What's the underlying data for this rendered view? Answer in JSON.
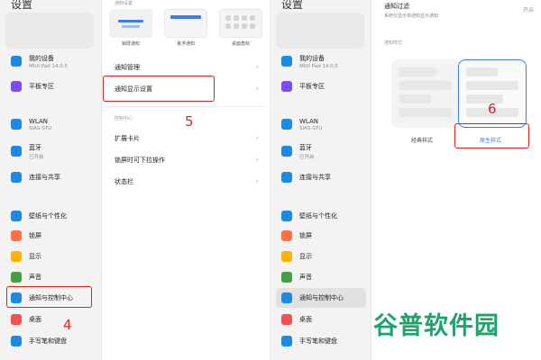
{
  "panel1": {
    "header": "设置",
    "items": [
      {
        "label": "我的设备",
        "sub": "MIUI Pad 14.0.5",
        "icon": "device-icon",
        "color": "#1e88e5"
      },
      {
        "label": "平板专区",
        "sub": "",
        "icon": "tablet-zone-icon",
        "color": "#7c4dff"
      },
      {
        "label": "WLAN",
        "sub": "SIAS-STU",
        "icon": "wifi-icon",
        "color": "#1e88e5"
      },
      {
        "label": "蓝牙",
        "sub": "已开启",
        "icon": "bluetooth-icon",
        "color": "#1e88e5"
      },
      {
        "label": "连接与共享",
        "sub": "",
        "icon": "share-icon",
        "color": "#1e88e5"
      },
      {
        "label": "壁纸与个性化",
        "sub": "",
        "icon": "wallpaper-icon",
        "color": "#1e88e5"
      },
      {
        "label": "锁屏",
        "sub": "",
        "icon": "lock-icon",
        "color": "#ff7043"
      },
      {
        "label": "显示",
        "sub": "",
        "icon": "display-icon",
        "color": "#ffb300"
      },
      {
        "label": "声音",
        "sub": "",
        "icon": "sound-icon",
        "color": "#43a047"
      },
      {
        "label": "通知与控制中心",
        "sub": "",
        "icon": "notification-icon",
        "color": "#1e88e5"
      },
      {
        "label": "桌面",
        "sub": "",
        "icon": "home-icon",
        "color": "#ef5350"
      },
      {
        "label": "手写笔和键盘",
        "sub": "",
        "icon": "pen-icon",
        "color": "#1e88e5"
      }
    ]
  },
  "panel2": {
    "header": "通知设置",
    "thumbs": [
      "锁屏通知",
      "悬浮通知",
      "桌面角标"
    ],
    "rows1": [
      "通知管理",
      "通知显示设置"
    ],
    "section": "控制中心",
    "rows2": [
      "扩展卡片",
      "锁屏时可下拉操作",
      "状态栏"
    ]
  },
  "panel4": {
    "filter_label": "通知过滤",
    "filter_sub": "系统仅显示将通知显示通知",
    "filter_value": "开启",
    "style_section": "通知样式",
    "style_classic": "经典样式",
    "style_native": "原生样式"
  },
  "annotations": {
    "step4": "4",
    "step5": "5",
    "step6": "6"
  },
  "watermark": "谷普软件园"
}
